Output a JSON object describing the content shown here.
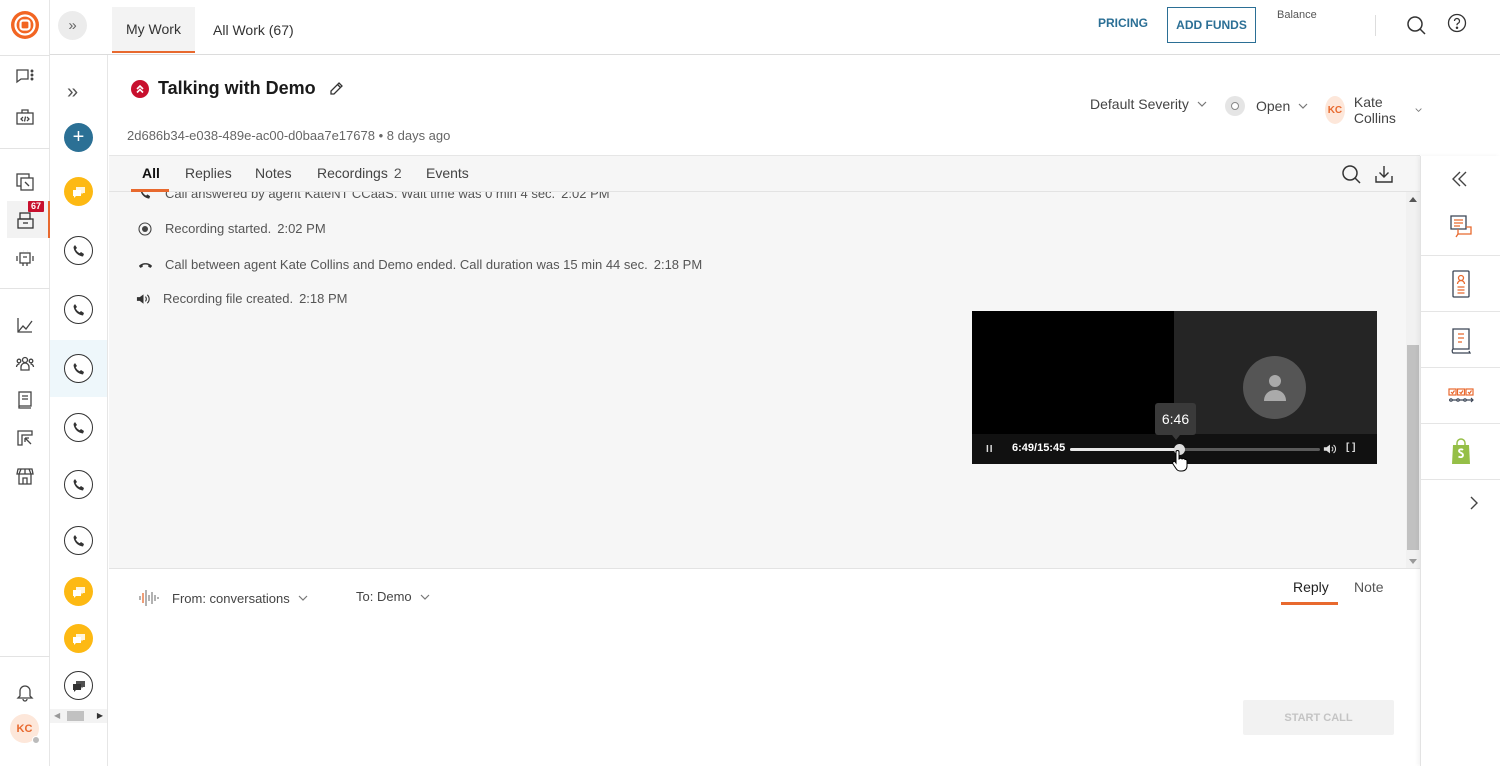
{
  "topbar": {
    "tabs": [
      {
        "label": "My Work",
        "active": true
      },
      {
        "label": "All Work (67)",
        "active": false
      }
    ],
    "pricing_label": "PRICING",
    "add_funds_label": "ADD FUNDS",
    "balance_label": "Balance"
  },
  "rail": {
    "badge_count": "67",
    "avatar_initials": "KC",
    "items": [
      "conversations-icon",
      "developer-icon",
      "copy-icon",
      "inbox-icon",
      "bot-icon",
      "analytics-icon",
      "contacts-icon",
      "knowledge-icon",
      "reports-icon",
      "store-icon",
      "bell-icon"
    ]
  },
  "conversation_list": {
    "items": [
      {
        "type": "chat",
        "icon": "chat-icon"
      },
      {
        "type": "phone",
        "icon": "phone-icon"
      },
      {
        "type": "phone",
        "icon": "phone-icon"
      },
      {
        "type": "phone",
        "icon": "phone-icon",
        "selected": true
      },
      {
        "type": "phone",
        "icon": "phone-icon"
      },
      {
        "type": "phone",
        "icon": "phone-icon"
      },
      {
        "type": "phone",
        "icon": "phone-icon"
      },
      {
        "type": "chat",
        "icon": "chat-icon"
      },
      {
        "type": "chat",
        "icon": "chat-icon"
      },
      {
        "type": "chat-outline",
        "icon": "chat-icon"
      }
    ]
  },
  "header": {
    "title": "Talking with Demo",
    "conversation_id": "2d686b34-e038-489e-ac00-d0baa7e17678",
    "separator": "•",
    "age": "8 days ago",
    "severity": "Default Severity",
    "status": "Open",
    "assignee_initials": "KC",
    "assignee": "Kate Collins"
  },
  "timeline": {
    "tabs": [
      {
        "label": "All",
        "active": true
      },
      {
        "label": "Replies"
      },
      {
        "label": "Notes"
      },
      {
        "label": "Recordings",
        "count": "2"
      },
      {
        "label": "Events"
      }
    ],
    "events": [
      {
        "icon": "phone-icon",
        "text": "Call answered by agent KateNT CCaaS. Wait time was 0 min 4 sec.",
        "time": "2:02 PM"
      },
      {
        "icon": "record-icon",
        "text": "Recording started.",
        "time": "2:02 PM"
      },
      {
        "icon": "hangup-icon",
        "text": "Call between agent Kate Collins and Demo ended. Call duration was 15 min 44 sec.",
        "time": "2:18 PM"
      },
      {
        "icon": "speaker-icon",
        "text": "Recording file created.",
        "time": "2:18 PM"
      }
    ]
  },
  "player": {
    "timecode": "6:49/15:45",
    "hover_time": "6:46",
    "progress_fraction": 0.434,
    "pause_glyph": "II",
    "fullscreen_glyph": "[ ]"
  },
  "composer": {
    "from_label": "From: conversations",
    "to_label": "To: Demo",
    "tabs": [
      {
        "label": "Reply",
        "active": true
      },
      {
        "label": "Note"
      }
    ],
    "start_call_label": "START CALL"
  },
  "colors": {
    "accent": "#e8692e",
    "link": "#2b6f95",
    "severity": "#c8102e",
    "chat": "#fdb913",
    "add_button": "#2b7095",
    "shopify": "#95bf47"
  }
}
